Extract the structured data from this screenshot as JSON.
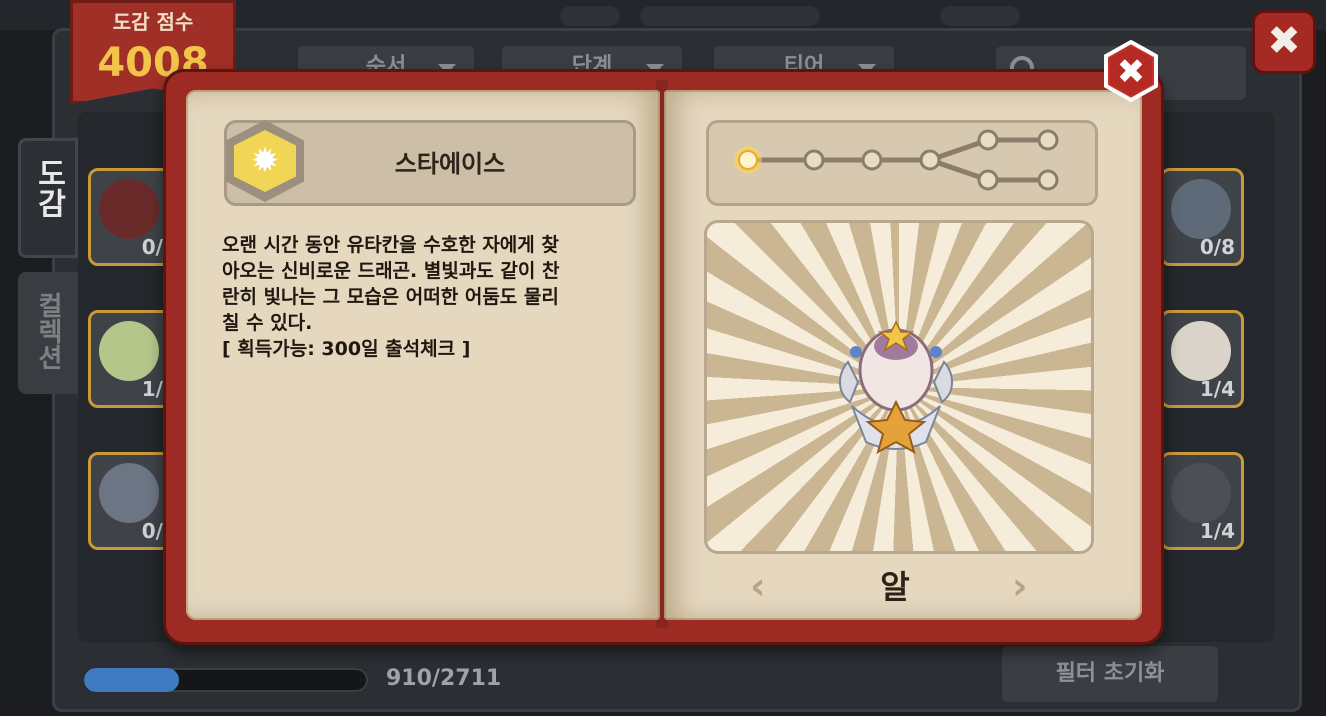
{
  "score": {
    "label": "도감 점수",
    "value": "4008"
  },
  "header": {
    "dropdowns": [
      {
        "label": "순서"
      },
      {
        "label": "단계"
      },
      {
        "label": "티어"
      }
    ]
  },
  "tabs": {
    "active": "도감",
    "inactive": "컬렉션"
  },
  "cards_left": [
    {
      "count": "0/"
    },
    {
      "count": "1/"
    },
    {
      "count": "0/"
    }
  ],
  "cards_right": [
    {
      "count": "0/8"
    },
    {
      "count": "1/4"
    },
    {
      "count": "1/4"
    }
  ],
  "book": {
    "dragon_name": "스타에이스",
    "description_lines": [
      "오랜 시간 동안 유타칸을 수호한 자에게 찾",
      "아오는 신비로운 드래곤. 별빛과도 같이 찬",
      "란히 빛나는 그 모습은 어떠한 어둠도 물리",
      "칠 수 있다.",
      "[ 획득가능: 300일 출석체크 ]"
    ],
    "stage_name": "알",
    "prev_arrow": "‹",
    "next_arrow": "›",
    "evolution_current_stage": 1,
    "medal_color": "#f1d557"
  },
  "footer": {
    "progress_text": "910/2711",
    "progress_fraction": 0.336,
    "filter_button": "필터 초기화"
  },
  "icons": {
    "close": "✖",
    "medal_star": "✹"
  },
  "colors": {
    "book_cover": "#9e2a24",
    "page": "#e5d8bf",
    "progress": "#3e7bc1",
    "card_border": "#c89a3c"
  }
}
